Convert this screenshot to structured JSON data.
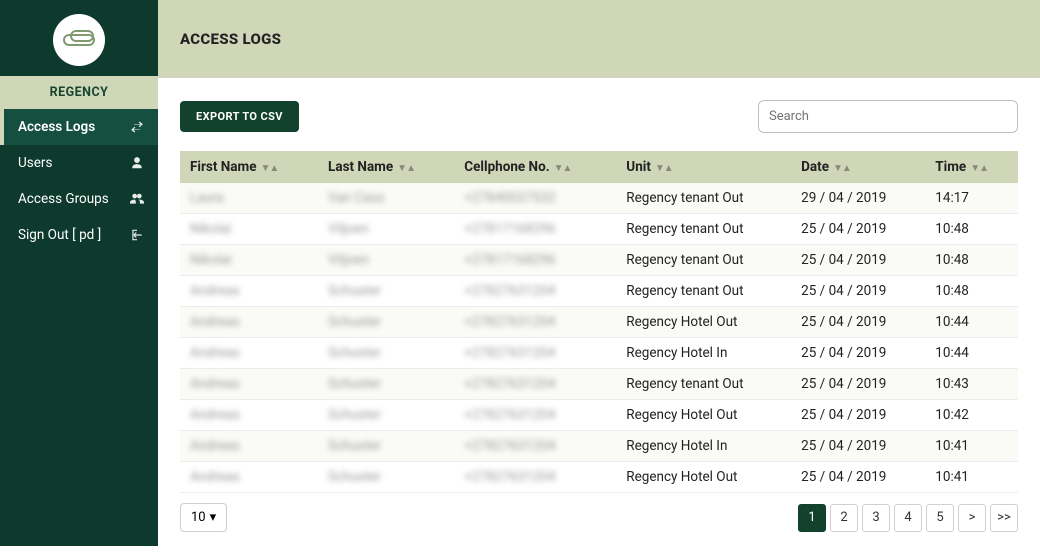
{
  "sidebar": {
    "tenant": "REGENCY",
    "items": [
      {
        "label": "Access Logs",
        "icon": "swap-icon",
        "active": true
      },
      {
        "label": "Users",
        "icon": "person-icon",
        "active": false
      },
      {
        "label": "Access Groups",
        "icon": "group-icon",
        "active": false
      },
      {
        "label": "Sign Out [ pd ]",
        "icon": "signout-icon",
        "active": false
      }
    ]
  },
  "header": {
    "title": "ACCESS LOGS"
  },
  "toolbar": {
    "export_label": "EXPORT TO CSV",
    "search_placeholder": "Search",
    "search_value": ""
  },
  "table": {
    "columns": [
      {
        "label": "First Name",
        "sortable": true
      },
      {
        "label": "Last Name",
        "sortable": true
      },
      {
        "label": "Cellphone No.",
        "sortable": true
      },
      {
        "label": "Unit",
        "sortable": true
      },
      {
        "label": "Date",
        "sortable": true
      },
      {
        "label": "Time",
        "sortable": true
      }
    ],
    "rows": [
      {
        "first": "Laura",
        "last": "Van Cass",
        "cell": "+27840037532",
        "unit": "Regency tenant Out",
        "date": "29 / 04 / 2019",
        "time": "14:17"
      },
      {
        "first": "Nikolai",
        "last": "Viljoen",
        "cell": "+27817168296",
        "unit": "Regency tenant Out",
        "date": "25 / 04 / 2019",
        "time": "10:48"
      },
      {
        "first": "Nikolai",
        "last": "Viljoen",
        "cell": "+27817168296",
        "unit": "Regency tenant Out",
        "date": "25 / 04 / 2019",
        "time": "10:48"
      },
      {
        "first": "Andreas",
        "last": "Schuster",
        "cell": "+27827631204",
        "unit": "Regency tenant Out",
        "date": "25 / 04 / 2019",
        "time": "10:48"
      },
      {
        "first": "Andreas",
        "last": "Schuster",
        "cell": "+27827631204",
        "unit": "Regency Hotel Out",
        "date": "25 / 04 / 2019",
        "time": "10:44"
      },
      {
        "first": "Andreas",
        "last": "Schuster",
        "cell": "+27827631204",
        "unit": "Regency Hotel In",
        "date": "25 / 04 / 2019",
        "time": "10:44"
      },
      {
        "first": "Andreas",
        "last": "Schuster",
        "cell": "+27827631204",
        "unit": "Regency tenant Out",
        "date": "25 / 04 / 2019",
        "time": "10:43"
      },
      {
        "first": "Andreas",
        "last": "Schuster",
        "cell": "+27827631204",
        "unit": "Regency Hotel Out",
        "date": "25 / 04 / 2019",
        "time": "10:42"
      },
      {
        "first": "Andreas",
        "last": "Schuster",
        "cell": "+27827631204",
        "unit": "Regency Hotel In",
        "date": "25 / 04 / 2019",
        "time": "10:41"
      },
      {
        "first": "Andreas",
        "last": "Schuster",
        "cell": "+27827631204",
        "unit": "Regency Hotel Out",
        "date": "25 / 04 / 2019",
        "time": "10:41"
      }
    ]
  },
  "pagination": {
    "page_size": "10",
    "pages": [
      "1",
      "2",
      "3",
      "4",
      "5"
    ],
    "active_page": "1",
    "next": ">",
    "last": ">>"
  },
  "colors": {
    "brand_dark": "#0d3a2d",
    "brand_mid": "#154f3f",
    "accent": "#d0d7b9"
  }
}
